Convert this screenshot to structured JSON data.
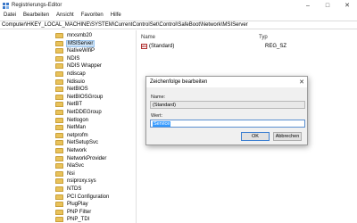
{
  "window": {
    "title": "Registrierungs-Editor",
    "minimize": "–",
    "maximize": "□",
    "close": "✕"
  },
  "menu": [
    "Datei",
    "Bearbeiten",
    "Ansicht",
    "Favoriten",
    "Hilfe"
  ],
  "path": "Computer\\HKEY_LOCAL_MACHINE\\SYSTEM\\CurrentControlSet\\Control\\SafeBoot\\Network\\MSIServer",
  "tree": {
    "items": [
      {
        "label": "mrxsmb20",
        "selected": false
      },
      {
        "label": "MSIServer",
        "selected": true
      },
      {
        "label": "NativeWifiP",
        "selected": false
      },
      {
        "label": "NDIS",
        "selected": false
      },
      {
        "label": "NDIS Wrapper",
        "selected": false
      },
      {
        "label": "ndiscap",
        "selected": false
      },
      {
        "label": "Ndisuio",
        "selected": false
      },
      {
        "label": "NetBIOS",
        "selected": false
      },
      {
        "label": "NetBIOSGroup",
        "selected": false
      },
      {
        "label": "NetBT",
        "selected": false
      },
      {
        "label": "NetDDEGroup",
        "selected": false
      },
      {
        "label": "Netlogon",
        "selected": false
      },
      {
        "label": "NetMan",
        "selected": false
      },
      {
        "label": "netprofm",
        "selected": false
      },
      {
        "label": "NetSetupSvc",
        "selected": false
      },
      {
        "label": "Network",
        "selected": false
      },
      {
        "label": "NetworkProvider",
        "selected": false
      },
      {
        "label": "NlaSvc",
        "selected": false
      },
      {
        "label": "Nsi",
        "selected": false
      },
      {
        "label": "nsiproxy.sys",
        "selected": false
      },
      {
        "label": "NTDS",
        "selected": false
      },
      {
        "label": "PCI Configuration",
        "selected": false
      },
      {
        "label": "PlugPlay",
        "selected": false
      },
      {
        "label": "PNP Filter",
        "selected": false
      },
      {
        "label": "PNP_TDI",
        "selected": false
      }
    ]
  },
  "list": {
    "columns": {
      "name": "Name",
      "type": "Typ"
    },
    "rows": [
      {
        "icon": "string-value-icon",
        "icon_text": "ab",
        "name": "(Standard)",
        "type": "REG_SZ"
      }
    ]
  },
  "dialog": {
    "title": "Zeichenfolge bearbeiten",
    "close": "✕",
    "name_label": "Name:",
    "name_value": "(Standard)",
    "value_label": "Wert:",
    "value_value": "Service",
    "ok": "OK",
    "cancel": "Abbrechen"
  },
  "colors": {
    "folder": "#e9c25a",
    "selection": "#cde3f7",
    "text_selection": "#3399ff"
  }
}
